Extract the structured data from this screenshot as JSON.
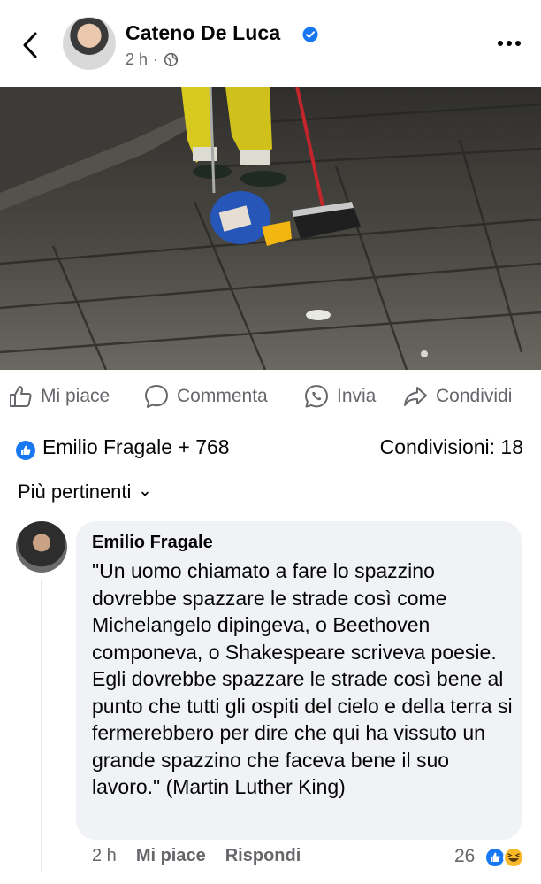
{
  "post": {
    "author": "Cateno De Luca",
    "time": "2 h",
    "separator": "·"
  },
  "actions": {
    "like": "Mi piace",
    "comment": "Commenta",
    "send": "Invia",
    "share": "Condividi"
  },
  "reactions": {
    "summary": "Emilio Fragale + 768",
    "shares": "Condivisioni: 18"
  },
  "filter": {
    "label": "Più pertinenti"
  },
  "comment": {
    "author": "Emilio Fragale",
    "text": "\"Un uomo chiamato a fare lo spazzino dovrebbe spazzare le strade così come Michelangelo dipingeva, o Beethoven componeva, o Shakespeare scriveva poesie. Egli dovrebbe spazzare le strade così bene al punto che tutti gli ospiti del cielo e della terra si fermerebbero per dire che qui ha vissuto un grande spazzino che faceva bene il suo lavoro.\" (Martin Luther King)",
    "time": "2 h",
    "like": "Mi piace",
    "reply": "Rispondi",
    "reaction_count": "26"
  },
  "colors": {
    "accent": "#1877f2",
    "muted": "#65676b",
    "bubble": "#f0f2f5"
  },
  "icons": {
    "back": "chevron-left-icon",
    "verified": "verified-badge-icon",
    "audience": "globe-icon",
    "more": "more-icon",
    "like": "thumbs-up-icon",
    "comment": "comment-icon",
    "send": "whatsapp-icon",
    "share": "share-icon"
  }
}
